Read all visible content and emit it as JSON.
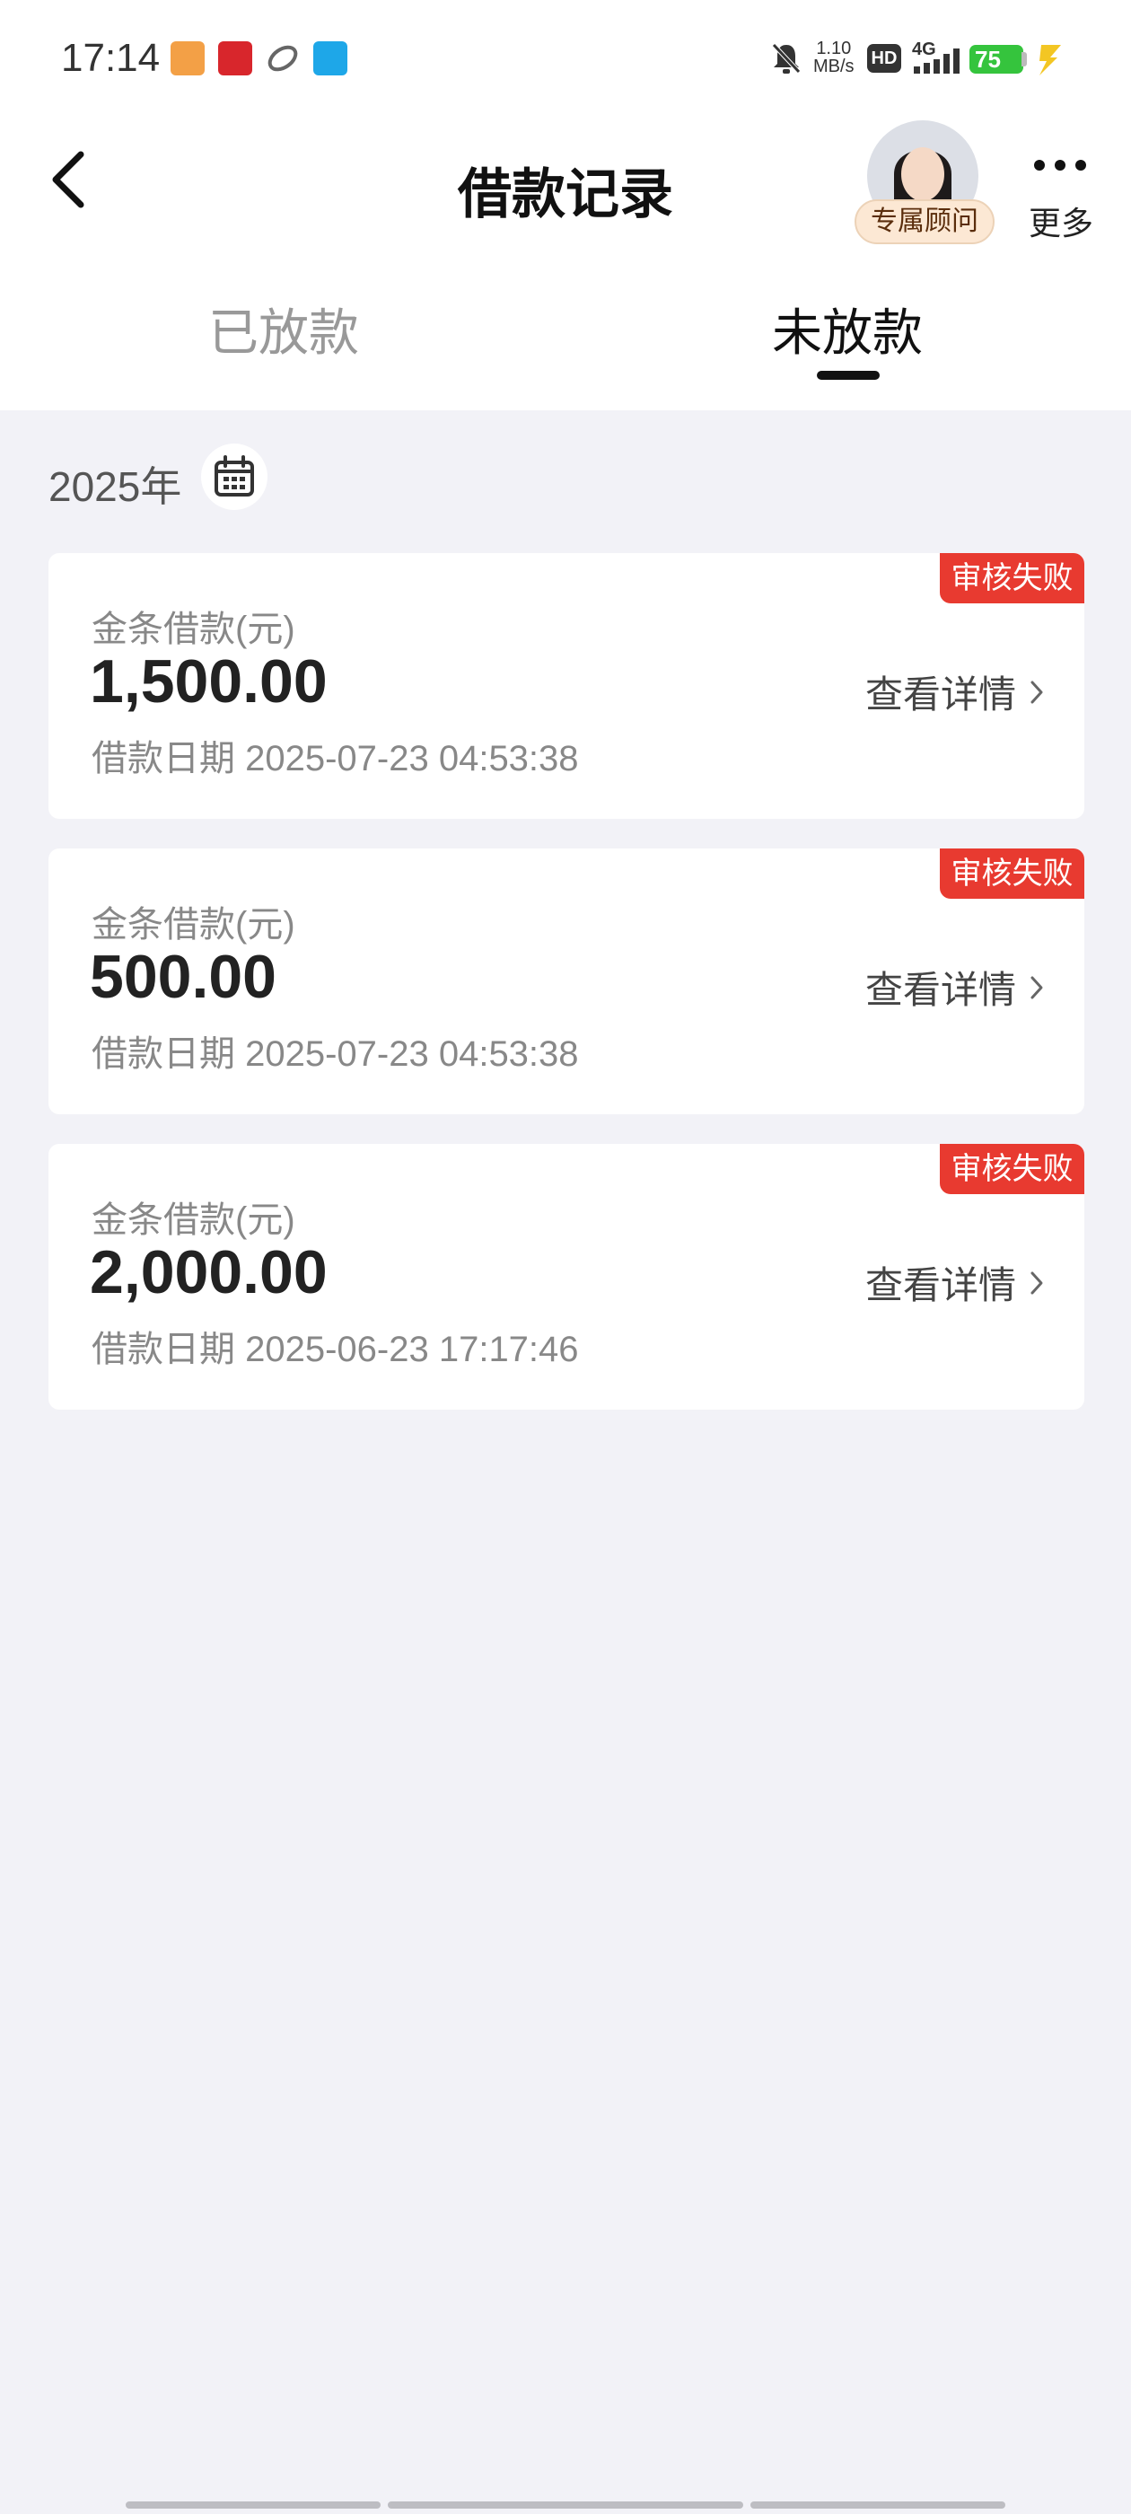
{
  "status_bar": {
    "time": "17:14",
    "net_speed_value": "1.10",
    "net_speed_unit": "MB/s",
    "hd_label": "HD",
    "signal_label": "4G",
    "battery": "75",
    "icons": [
      "app-icon-1",
      "app-icon-2",
      "app-icon-3",
      "app-icon-4",
      "mute-icon",
      "signal-icon",
      "charging-icon"
    ]
  },
  "header": {
    "title": "借款记录",
    "advisor_label": "专属顾问",
    "more_label": "更多"
  },
  "tabs": [
    {
      "label": "已放款",
      "active": false
    },
    {
      "label": "未放款",
      "active": true
    }
  ],
  "year_filter": {
    "label": "2025年"
  },
  "records": [
    {
      "badge": "审核失败",
      "label": "金条借款(元)",
      "amount": "1,500.00",
      "date": "借款日期 2025-07-23 04:53:38",
      "action": "查看详情"
    },
    {
      "badge": "审核失败",
      "label": "金条借款(元)",
      "amount": "500.00",
      "date": "借款日期 2025-07-23 04:53:38",
      "action": "查看详情"
    },
    {
      "badge": "审核失败",
      "label": "金条借款(元)",
      "amount": "2,000.00",
      "date": "借款日期 2025-06-23 17:17:46",
      "action": "查看详情"
    }
  ],
  "colors": {
    "badge": "#e83a30",
    "background": "#f2f2f7",
    "battery": "#35c43d",
    "advisor_badge": "#fce8d4"
  }
}
